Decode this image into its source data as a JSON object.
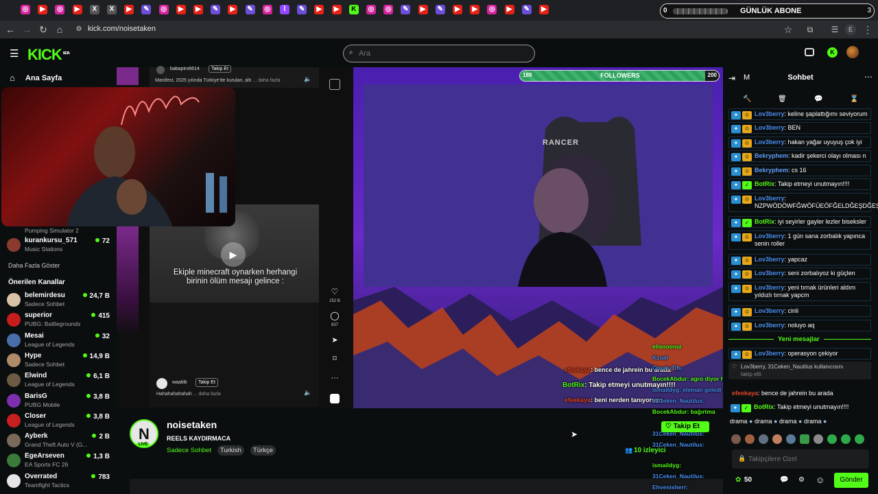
{
  "browser": {
    "url": "kick.com/noisetaken",
    "tab_icons": [
      "ig",
      "yt",
      "ig",
      "yt",
      "x",
      "x",
      "yt",
      "feather",
      "ig",
      "yt",
      "yt",
      "feather",
      "yt",
      "feather",
      "ig",
      "twitch",
      "feather",
      "yt",
      "yt",
      "kick",
      "ig",
      "ig",
      "feather",
      "yt",
      "feather",
      "yt",
      "yt",
      "ig",
      "yt",
      "feather",
      "yt"
    ],
    "overlay_banner": {
      "left": "0",
      "title": "GÜNLÜK ABONE",
      "right": "3"
    }
  },
  "header": {
    "logo": "KICK",
    "logo_beta": "BETA",
    "search_placeholder": "Ara"
  },
  "sidebar": {
    "home": "Ana Sayfa",
    "following": [
      {
        "game": "Pumping Simulator 2"
      },
      {
        "name": "kurankursu_571",
        "game": "Music Stations",
        "count": "72",
        "color": "#8b3a2e"
      }
    ],
    "show_more": "Daha Fazla Göster",
    "recommended_title": "Önerilen Kanallar",
    "recommended": [
      {
        "name": "belemirdesu",
        "game": "Sadece Sohbet",
        "count": "24,7 B",
        "color": "#d9c3a7"
      },
      {
        "name": "superior",
        "game": "PUBG: Battlegrounds",
        "count": "415",
        "color": "#c81d1d"
      },
      {
        "name": "Mesai",
        "game": "League of Legends",
        "count": "32",
        "color": "#4a6ea8"
      },
      {
        "name": "Hype",
        "game": "Sadece Sohbet",
        "count": "14,9 B",
        "color": "#b08b6a"
      },
      {
        "name": "Elwind",
        "game": "League of Legends",
        "count": "6,1 B",
        "color": "#6c5a44"
      },
      {
        "name": "BarisG",
        "game": "PUBG Mobile",
        "count": "3,8 B",
        "color": "#7d2fb0"
      },
      {
        "name": "Closer",
        "game": "League of Legends",
        "count": "3,8 B",
        "color": "#c82020"
      },
      {
        "name": "Ayberk",
        "game": "Grand Theft Auto V (G...",
        "count": "2 B",
        "color": "#7a6a5a"
      },
      {
        "name": "EgeArseven",
        "game": "EA Sports FC 26",
        "count": "1,3 B",
        "color": "#3a7a3a"
      },
      {
        "name": "Overrated",
        "game": "Teamfight Tactics",
        "count": "783",
        "color": "#e6e6e6"
      }
    ]
  },
  "reels": {
    "top_user": "babapiro6614",
    "top_follow": "Takip Et",
    "top_desc": "Manifest, 2025 yılında Türkiye'de kurulan, altı",
    "top_more": "... daha fazla",
    "video_caption": "Ekiple minecraft oynarken herhangi birinin ölüm mesajı gelince :",
    "bottom_user": "waatitk",
    "bottom_follow": "Takip Et",
    "bottom_desc": "Hahahahahahah",
    "bottom_more": "... daha fazla",
    "likes": "252 B",
    "comments": "837"
  },
  "stream": {
    "followers_left": "189",
    "followers_label": "FOLLOWERS",
    "followers_right": "200",
    "followers_progress": 0.93,
    "chair_brand": "RANCER",
    "overlay_chat": [
      {
        "user": "efeekaya",
        "text": ": bence de jahrein bu arada"
      },
      {
        "user": "BotRix",
        "text": ": Takip etmeyi unutmayın!!!!"
      },
      {
        "user": "efeekaya",
        "text": ": beni nerden tanıyorsun"
      }
    ]
  },
  "channel": {
    "avatar_letter": "N",
    "live": "LIVE",
    "name": "noisetaken",
    "title": "REELS KAYDIRMACA",
    "category": "Sadece Sohbet",
    "tags": [
      "Turkish",
      "Türkçe"
    ],
    "viewers": "10 izleyici",
    "follow": "Takip Et"
  },
  "chat": {
    "title": "Sohbet",
    "header_left": "M",
    "messages": [
      {
        "user": "Lov3berry",
        "text": ": keline şaplattığımı seviyorum",
        "color": "blue"
      },
      {
        "user": "Lov3berry",
        "text": ": BEN",
        "color": "blue"
      },
      {
        "user": "Lov3berry",
        "text": ": hakan yağar uyuyuş çok iyi",
        "color": "blue"
      },
      {
        "user": "Bekryphem",
        "text": ": kadir şekerci olayı olması n",
        "color": "blue2"
      },
      {
        "user": "Bekryphem",
        "text": ": cs 16",
        "color": "blue2"
      },
      {
        "user": "BotRix",
        "text": ": Takip etmeyi unutmayın!!!!",
        "color": "green"
      },
      {
        "user": "Lov3berry",
        "text": ": NZPWÖDÖWFĞWÖFÜEÖFĞELDĞEŞDĞEŞ",
        "color": "blue"
      },
      {
        "user": "BotRix",
        "text": ": iyi seyirler gayler lezler biseksler",
        "color": "green"
      },
      {
        "user": "Lov3berry",
        "text": ": 1 gün sana zorbalık yapınca senin roller",
        "color": "blue"
      },
      {
        "user": "Lov3berry",
        "text": ": yapcaz",
        "color": "blue"
      },
      {
        "user": "Lov3berry",
        "text": ": seni zorbalıyoz ki güçlen",
        "color": "blue"
      },
      {
        "user": "Lov3berry",
        "text": ": yeni tırnak ürünleri aldım yıldızlı tırnak yapcm",
        "color": "blue"
      },
      {
        "user": "Lov3berry",
        "text": ": cinli",
        "color": "blue"
      },
      {
        "user": "Lov3berry",
        "text": ": noluyo aq",
        "color": "blue"
      }
    ],
    "new_messages": "Yeni mesajlar",
    "after_new": {
      "user": "Lov3berry",
      "text": ": operasyon çekiyor"
    },
    "system": "Lov3berry, 31Ceken_Nautilus kullanıcısını",
    "system2": "takip etti",
    "plain1": {
      "user": "efeekaya",
      "text": ": bence de jahrein bu arada"
    },
    "plain2": {
      "user": "BotRix",
      "text": ": Takip etmeyi unutmayın!!!!"
    },
    "drama": "drama",
    "input_placeholder": "Takipçilere Özel",
    "points": "50",
    "send": "Gönder"
  },
  "overlay_list": [
    "elisnoonui",
    "Kzuaf",
    "OnurluTifu",
    "BocekAbdur: agro diyor hala ya",
    "ismaildyg: eleman geledi",
    "31Ceken_Nautilus:",
    "BocekAbdur: bağırtma",
    "31Ceken_Nautilus:",
    "31Ceken_Nautilus:",
    "ismaildyg:",
    "31Ceken_Nautilus:",
    "Ehvenisherr:"
  ]
}
